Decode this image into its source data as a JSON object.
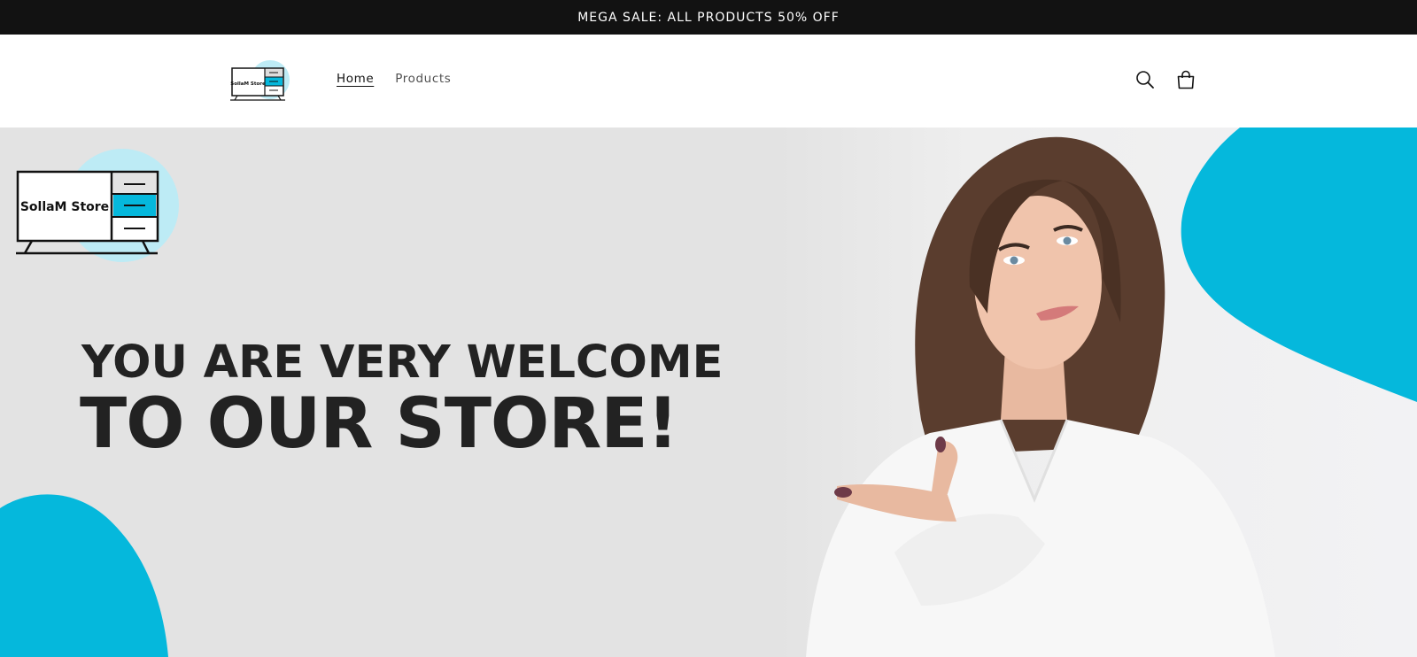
{
  "announcement": {
    "text": "MEGA SALE: ALL PRODUCTS 50% OFF"
  },
  "header": {
    "logo_text": "SollaM Store",
    "nav": [
      {
        "label": "Home",
        "active": true
      },
      {
        "label": "Products",
        "active": false
      }
    ],
    "icons": [
      "search-icon",
      "cart-icon"
    ]
  },
  "hero": {
    "logo_text": "SollaM Store",
    "headline_line1": "YOU ARE VERY WELCOME",
    "headline_line2": "TO OUR STORE!"
  },
  "colors": {
    "accent": "#05B8DC",
    "accent_light": "#BDEBF5",
    "announcement_bg": "#121212",
    "hero_bg": "#E3E3E3",
    "headline": "#222222"
  }
}
